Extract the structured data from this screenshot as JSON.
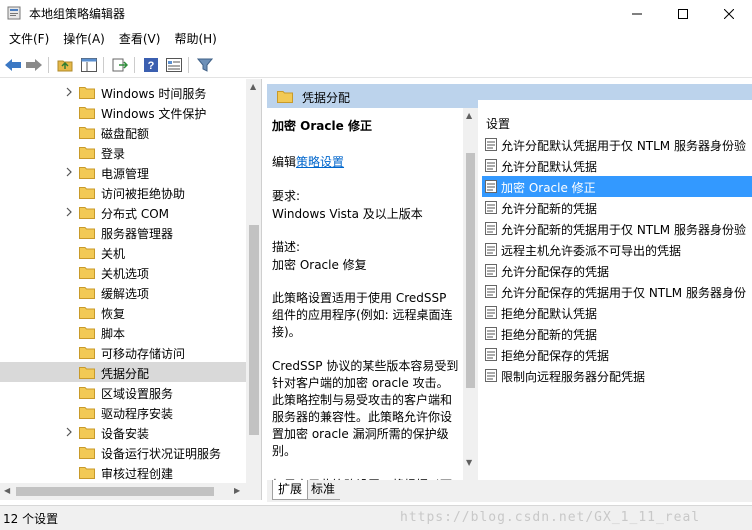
{
  "window": {
    "title": "本地组策略编辑器"
  },
  "menu": [
    "文件(F)",
    "操作(A)",
    "查看(V)",
    "帮助(H)"
  ],
  "toolbar": [
    "back-icon",
    "forward-icon",
    "up-folder-icon",
    "show-hide-tree-icon",
    "export-list-icon",
    "help-icon",
    "properties-icon",
    "filter-icon"
  ],
  "tree": {
    "items": [
      {
        "label": "Windows 时间服务",
        "expandable": true
      },
      {
        "label": "Windows 文件保护",
        "expandable": false
      },
      {
        "label": "磁盘配额",
        "expandable": false
      },
      {
        "label": "登录",
        "expandable": false
      },
      {
        "label": "电源管理",
        "expandable": true
      },
      {
        "label": "访问被拒绝协助",
        "expandable": false
      },
      {
        "label": "分布式 COM",
        "expandable": true
      },
      {
        "label": "服务器管理器",
        "expandable": false
      },
      {
        "label": "关机",
        "expandable": false
      },
      {
        "label": "关机选项",
        "expandable": false
      },
      {
        "label": "缓解选项",
        "expandable": false
      },
      {
        "label": "恢复",
        "expandable": false
      },
      {
        "label": "脚本",
        "expandable": false
      },
      {
        "label": "可移动存储访问",
        "expandable": false
      },
      {
        "label": "凭据分配",
        "expandable": false,
        "selected": true
      },
      {
        "label": "区域设置服务",
        "expandable": false
      },
      {
        "label": "驱动程序安装",
        "expandable": false
      },
      {
        "label": "设备安装",
        "expandable": true
      },
      {
        "label": "设备运行状况证明服务",
        "expandable": false
      },
      {
        "label": "审核过程创建",
        "expandable": false
      }
    ]
  },
  "right": {
    "header": "凭据分配",
    "description": {
      "title": "加密 Oracle 修正",
      "edit_prefix": "编辑",
      "edit_link": "策略设置",
      "req_label": "要求:",
      "req_value": "Windows Vista 及以上版本",
      "desc_label": "描述:",
      "desc_value": "加密 Oracle 修复",
      "p1": [
        "此策略设置适用于使用 CredSSP",
        "组件的应用程序(例如: 远程桌面连",
        "接)。"
      ],
      "p2": [
        "CredSSP 协议的某些版本容易受到",
        "针对客户端的加密 oracle 攻击。",
        "此策略控制与易受攻击的客户端和",
        "服务器的兼容性。此策略允许你设",
        "置加密 oracle 漏洞所需的保护级",
        "别。"
      ],
      "p3": [
        "如果启用此策略设置，将根据以下"
      ]
    },
    "list_header": "设置",
    "settings": [
      {
        "label": "允许分配默认凭据用于仅 NTLM 服务器身份验"
      },
      {
        "label": "允许分配默认凭据"
      },
      {
        "label": "加密 Oracle 修正",
        "selected": true
      },
      {
        "label": "允许分配新的凭据"
      },
      {
        "label": "允许分配新的凭据用于仅 NTLM 服务器身份验"
      },
      {
        "label": "远程主机允许委派不可导出的凭据"
      },
      {
        "label": "允许分配保存的凭据"
      },
      {
        "label": "允许分配保存的凭据用于仅 NTLM 服务器身份"
      },
      {
        "label": "拒绝分配默认凭据"
      },
      {
        "label": "拒绝分配新的凭据"
      },
      {
        "label": "拒绝分配保存的凭据"
      },
      {
        "label": "限制向远程服务器分配凭据"
      }
    ],
    "tabs": [
      "扩展",
      "标准"
    ]
  },
  "status": {
    "text": "12 个设置"
  },
  "watermark": "https://blog.csdn.net/GX_1_11_real",
  "colors": {
    "selection": "#3399ff",
    "header_bg": "#bcd3ec",
    "link": "#0066cc"
  }
}
